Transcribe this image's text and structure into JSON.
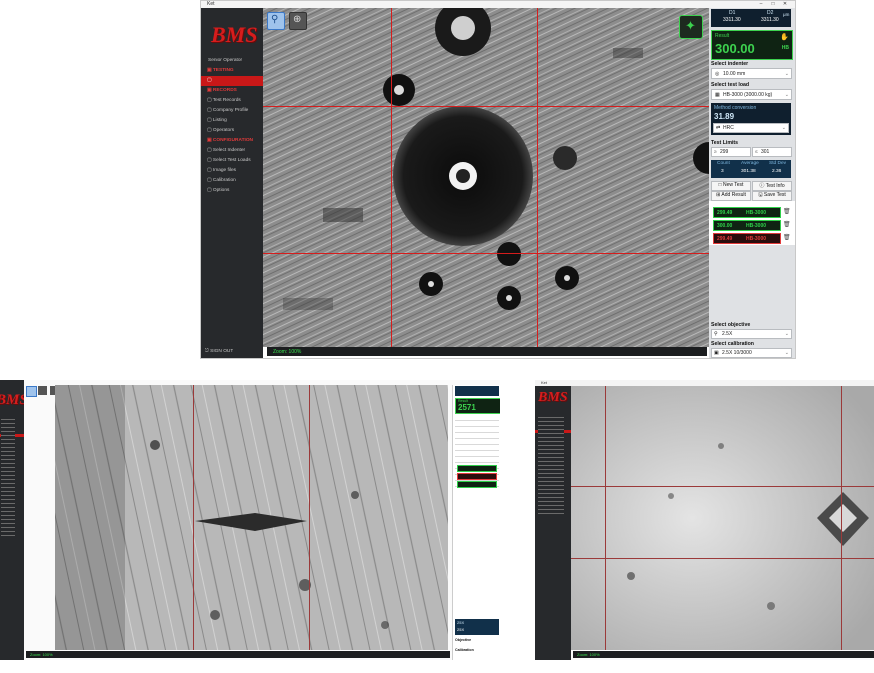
{
  "main": {
    "title": "Ket",
    "window_controls": [
      "–",
      "□",
      "✕"
    ],
    "brand": "BMS",
    "user": "Senior Operator",
    "nav": [
      {
        "label": "TESTING",
        "kind": "section"
      },
      {
        "label": "",
        "kind": "active"
      },
      {
        "label": "RECORDS",
        "kind": "section"
      },
      {
        "label": "Test Records",
        "kind": "item"
      },
      {
        "label": "Company Profile",
        "kind": "item"
      },
      {
        "label": "Listing",
        "kind": "item"
      },
      {
        "label": "Operators",
        "kind": "item"
      },
      {
        "label": "CONFIGURATION",
        "kind": "section"
      },
      {
        "label": "Select Indenter",
        "kind": "item"
      },
      {
        "label": "Select Test Loads",
        "kind": "item"
      },
      {
        "label": "Image files",
        "kind": "item"
      },
      {
        "label": "Calibration",
        "kind": "item"
      },
      {
        "label": "Options",
        "kind": "item"
      }
    ],
    "footer": "SIGN OUT",
    "status_text": "Zoom: 100%",
    "panel": {
      "d1_label": "D1",
      "d1_value": "3311.30",
      "d2_label": "D2",
      "d2_value": "3311.30",
      "unit": "μm",
      "result_label": "Result",
      "result_value": "300.00",
      "result_unit": "HB",
      "indenter_label": "Select indenter",
      "indenter_value": "10.00 mm",
      "load_label": "Select test load",
      "load_value": "HB-3000 (3000.00 kg)",
      "conversion_label": "Method conversion",
      "conversion_value": "31.89",
      "conversion_scale": "HRC",
      "limits_label": "Test Limits",
      "limit_min": "299",
      "limit_max": "301",
      "count_label": "Count",
      "count_value": "3",
      "average_label": "Average",
      "average_value": "301.38",
      "stddev_label": "Std Dev",
      "stddev_value": "2.36",
      "btn_new_test": "New Test",
      "btn_test_info": "Test Info",
      "btn_add_result": "Add Result",
      "btn_save_test": "Save Test",
      "results": [
        {
          "value": "299.49",
          "scale": "HB-3000",
          "ok": true
        },
        {
          "value": "300.00",
          "scale": "HB-3000",
          "ok": true
        },
        {
          "value": "299.49",
          "scale": "HB-3000",
          "ok": false
        }
      ],
      "objective_label": "Select objective",
      "objective_value": "2.5X",
      "calibration_label": "Select calibration",
      "calibration_value": "2.5X 10/3000"
    },
    "colors": {
      "accent": "#c91818",
      "ok": "#2fd04a",
      "bad": "#e23a3a",
      "crosshair": "#d61d1d"
    }
  },
  "left": {
    "brand": "BMS",
    "result_label": "Result",
    "result_value": "2571",
    "status_text": "Zoom: 100%",
    "objective_value": "25X",
    "calibration_value": "25X",
    "objective_label": "Objective",
    "calibration_label": "Calibration"
  },
  "right": {
    "title": "Ket",
    "brand": "BMS",
    "status_text": "Zoom: 100%"
  }
}
